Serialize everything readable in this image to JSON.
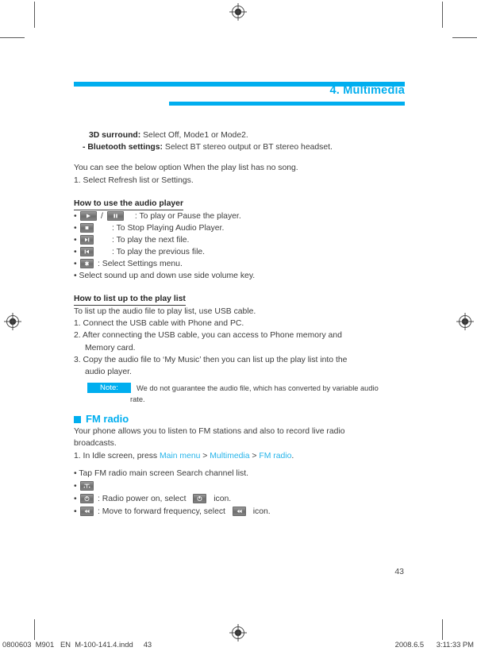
{
  "header": {
    "chapter_title": "4. Multimedia",
    "accent_color": "#00aeef"
  },
  "content": {
    "opt_3d_label": "3D surround:",
    "opt_3d_text": " Select Off, Mode1 or Mode2.",
    "opt_bt_label": "- Bluetooth settings:",
    "opt_bt_text": " Select BT stereo output or BT stereo headset.",
    "para_nosong": "You can see the below option When the play list has no song.",
    "step_refresh": "1. Select Refresh list or Settings.",
    "heading_audio_player": "How to use the audio player",
    "player_rows": [
      {
        "bullet": "•",
        "icons": [
          "play-icon",
          "pause-icon"
        ],
        "separator": "/",
        "text": ": To play or Pause the player."
      },
      {
        "bullet": "•",
        "icons": [
          "stop-icon"
        ],
        "separator": "",
        "text": ": To Stop Playing Audio Player."
      },
      {
        "bullet": "•",
        "icons": [
          "next-track-icon"
        ],
        "separator": "",
        "text": ": To play the next file."
      },
      {
        "bullet": "•",
        "icons": [
          "previous-track-icon"
        ],
        "separator": "",
        "text": ": To play the previous file."
      },
      {
        "bullet": "•",
        "icons": [
          "settings-icon"
        ],
        "separator": "",
        "text": ": Select Settings menu."
      }
    ],
    "player_volume_line": "• Select sound up and down use side volume key.",
    "heading_play_list": "How to list up to the play list",
    "playlist_intro": "To list up the audio file to play list, use USB cable.",
    "playlist_step_1": "1. Connect the USB cable with Phone and PC.",
    "playlist_step_2": "2. After connecting the USB cable, you can access to Phone memory and",
    "playlist_step_2b": "Memory card.",
    "playlist_step_3": "3. Copy the audio file to ‘My Music’ then you can list up the play list into the",
    "playlist_step_3b": "audio player.",
    "note_label": "Note:",
    "note_text": "We do not guarantee the audio file, which has converted by variable audio",
    "note_text_2": "rate.",
    "fm_heading": "FM radio",
    "fm_intro_1": "Your phone allows you to listen to FM stations and also to record live radio",
    "fm_intro_2": "broadcasts.",
    "fm_step_prefix": "1. In Idle screen, press ",
    "fm_link_1": "Main menu",
    "fm_sep_1": " > ",
    "fm_link_2": "Multimedia",
    "fm_sep_2": " > ",
    "fm_link_3": "FM radio",
    "fm_step_suffix": ".",
    "fm_bullet_tap": "• Tap FM radio main screen Search channel list.",
    "fm_rows": [
      {
        "bullet": "•",
        "icon": "antenna-icon",
        "text": "",
        "mid": "",
        "icon2": "",
        "tail": ""
      },
      {
        "bullet": "•",
        "icon": "power-icon",
        "text": ": Radio power on, select ",
        "icon2": "power-icon",
        "tail": " icon."
      },
      {
        "bullet": "•",
        "icon": "rewind-icon",
        "text": ": Move to forward frequency, select ",
        "icon2": "rewind-icon",
        "tail": " icon."
      }
    ]
  },
  "page_number": "43",
  "footer": {
    "left": "0800603  M901   EN  M-100-141.4.indd     43",
    "right": "2008.6.5      3:11:33 PM"
  }
}
